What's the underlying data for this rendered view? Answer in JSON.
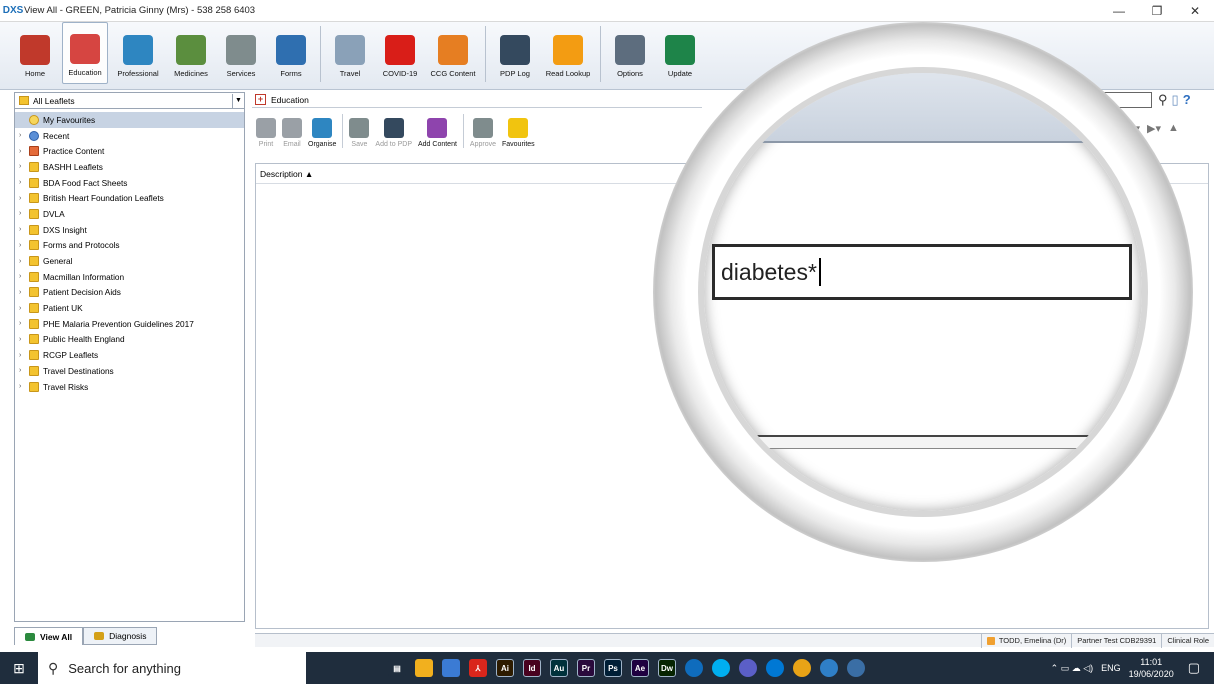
{
  "window": {
    "title": "View All - GREEN, Patricia Ginny (Mrs) - 538 258 6403",
    "app_icon": "DXS",
    "controls": [
      "—",
      "❐",
      "✕"
    ]
  },
  "ribbon": {
    "buttons": [
      {
        "label": "Home",
        "icon": "home-icon",
        "color": "#c0392b"
      },
      {
        "label": "Education",
        "icon": "education-icon",
        "color": "#d64541"
      },
      {
        "label": "Professional",
        "icon": "caduceus-icon",
        "color": "#2e86c1"
      },
      {
        "label": "Medicines",
        "icon": "capsule-icon",
        "color": "#5b8e3e"
      },
      {
        "label": "Services",
        "icon": "ambulance-icon",
        "color": "#7f8c8d"
      },
      {
        "label": "Forms",
        "icon": "forms-icon",
        "color": "#2f6fb0"
      },
      {
        "label": "Travel",
        "icon": "plane-icon",
        "color": "#8aa1b8"
      },
      {
        "label": "COVID-19",
        "icon": "alarm-icon",
        "color": "#d91e18"
      },
      {
        "label": "CCG Content",
        "icon": "people-icon",
        "color": "#e67e22"
      },
      {
        "label": "PDP Log",
        "icon": "graduate-icon",
        "color": "#34495e"
      },
      {
        "label": "Read Lookup",
        "icon": "stethoscope-icon",
        "color": "#f39c12"
      },
      {
        "label": "Options",
        "icon": "tools-icon",
        "color": "#5d6d7e"
      },
      {
        "label": "Update",
        "icon": "update-icon",
        "color": "#1e8449"
      }
    ]
  },
  "left": {
    "combo_value": "All Leaflets",
    "tree": [
      {
        "label": "My Favourites",
        "icon": "star",
        "selected": true,
        "expandable": false
      },
      {
        "label": "Recent",
        "icon": "clock",
        "selected": false,
        "expandable": true
      },
      {
        "label": "Practice Content",
        "icon": "practice",
        "selected": false,
        "expandable": true
      },
      {
        "label": "BASHH Leaflets",
        "icon": "folder",
        "selected": false,
        "expandable": true
      },
      {
        "label": "BDA Food Fact Sheets",
        "icon": "folder",
        "selected": false,
        "expandable": true
      },
      {
        "label": "British Heart Foundation Leaflets",
        "icon": "folder",
        "selected": false,
        "expandable": true
      },
      {
        "label": "DVLA",
        "icon": "folder",
        "selected": false,
        "expandable": true
      },
      {
        "label": "DXS Insight",
        "icon": "folder",
        "selected": false,
        "expandable": true
      },
      {
        "label": "Forms and Protocols",
        "icon": "folder",
        "selected": false,
        "expandable": true
      },
      {
        "label": "General",
        "icon": "folder",
        "selected": false,
        "expandable": true
      },
      {
        "label": "Macmillan Information",
        "icon": "folder",
        "selected": false,
        "expandable": true
      },
      {
        "label": "Patient Decision Aids",
        "icon": "folder",
        "selected": false,
        "expandable": true
      },
      {
        "label": "Patient UK",
        "icon": "folder",
        "selected": false,
        "expandable": true
      },
      {
        "label": "PHE Malaria Prevention Guidelines 2017",
        "icon": "folder",
        "selected": false,
        "expandable": true
      },
      {
        "label": "Public Health England",
        "icon": "folder",
        "selected": false,
        "expandable": true
      },
      {
        "label": "RCGP Leaflets",
        "icon": "folder",
        "selected": false,
        "expandable": true
      },
      {
        "label": "Travel Destinations",
        "icon": "folder",
        "selected": false,
        "expandable": true
      },
      {
        "label": "Travel Risks",
        "icon": "folder",
        "selected": false,
        "expandable": true
      }
    ],
    "tabs": [
      {
        "label": "View All",
        "active": true
      },
      {
        "label": "Diagnosis",
        "active": false
      }
    ]
  },
  "content": {
    "header": "Education",
    "toolbar": [
      {
        "label": "Print",
        "enabled": false,
        "color": "#9aa0a6"
      },
      {
        "label": "Email",
        "enabled": false,
        "color": "#9aa0a6"
      },
      {
        "label": "Organise",
        "enabled": true,
        "color": "#2e86c1"
      },
      {
        "label": "Save",
        "enabled": false,
        "color": "#7f8c8d"
      },
      {
        "label": "Add to PDP",
        "enabled": false,
        "color": "#34495e"
      },
      {
        "label": "Add Content",
        "enabled": true,
        "color": "#8e44ad"
      },
      {
        "label": "Approve",
        "enabled": false,
        "color": "#7f8c8d"
      },
      {
        "label": "Favourites",
        "enabled": true,
        "color": "#f1c40f"
      }
    ],
    "column_header": "Description ▲"
  },
  "magnifier": {
    "search_text": "diabetes*"
  },
  "status": {
    "user": "TODD, Emelina (Dr)",
    "practice": "Partner Test CDB29391",
    "role": "Clinical Role"
  },
  "taskbar": {
    "search_placeholder": "Search for anything",
    "language": "ENG",
    "time": "11:01",
    "date": "19/06/2020",
    "apps": [
      {
        "label": "Ai",
        "icon": "illustrator-icon",
        "color": "#2d1b00"
      },
      {
        "label": "Id",
        "icon": "indesign-icon",
        "color": "#49021f"
      },
      {
        "label": "Au",
        "icon": "audition-icon",
        "color": "#00313b"
      },
      {
        "label": "Pr",
        "icon": "premiere-icon",
        "color": "#2a0a3c"
      },
      {
        "label": "Ps",
        "icon": "photoshop-icon",
        "color": "#001e36"
      },
      {
        "label": "Ae",
        "icon": "aftereffects-icon",
        "color": "#1f0040"
      },
      {
        "label": "Dw",
        "icon": "dreamweaver-icon",
        "color": "#072401"
      }
    ]
  }
}
